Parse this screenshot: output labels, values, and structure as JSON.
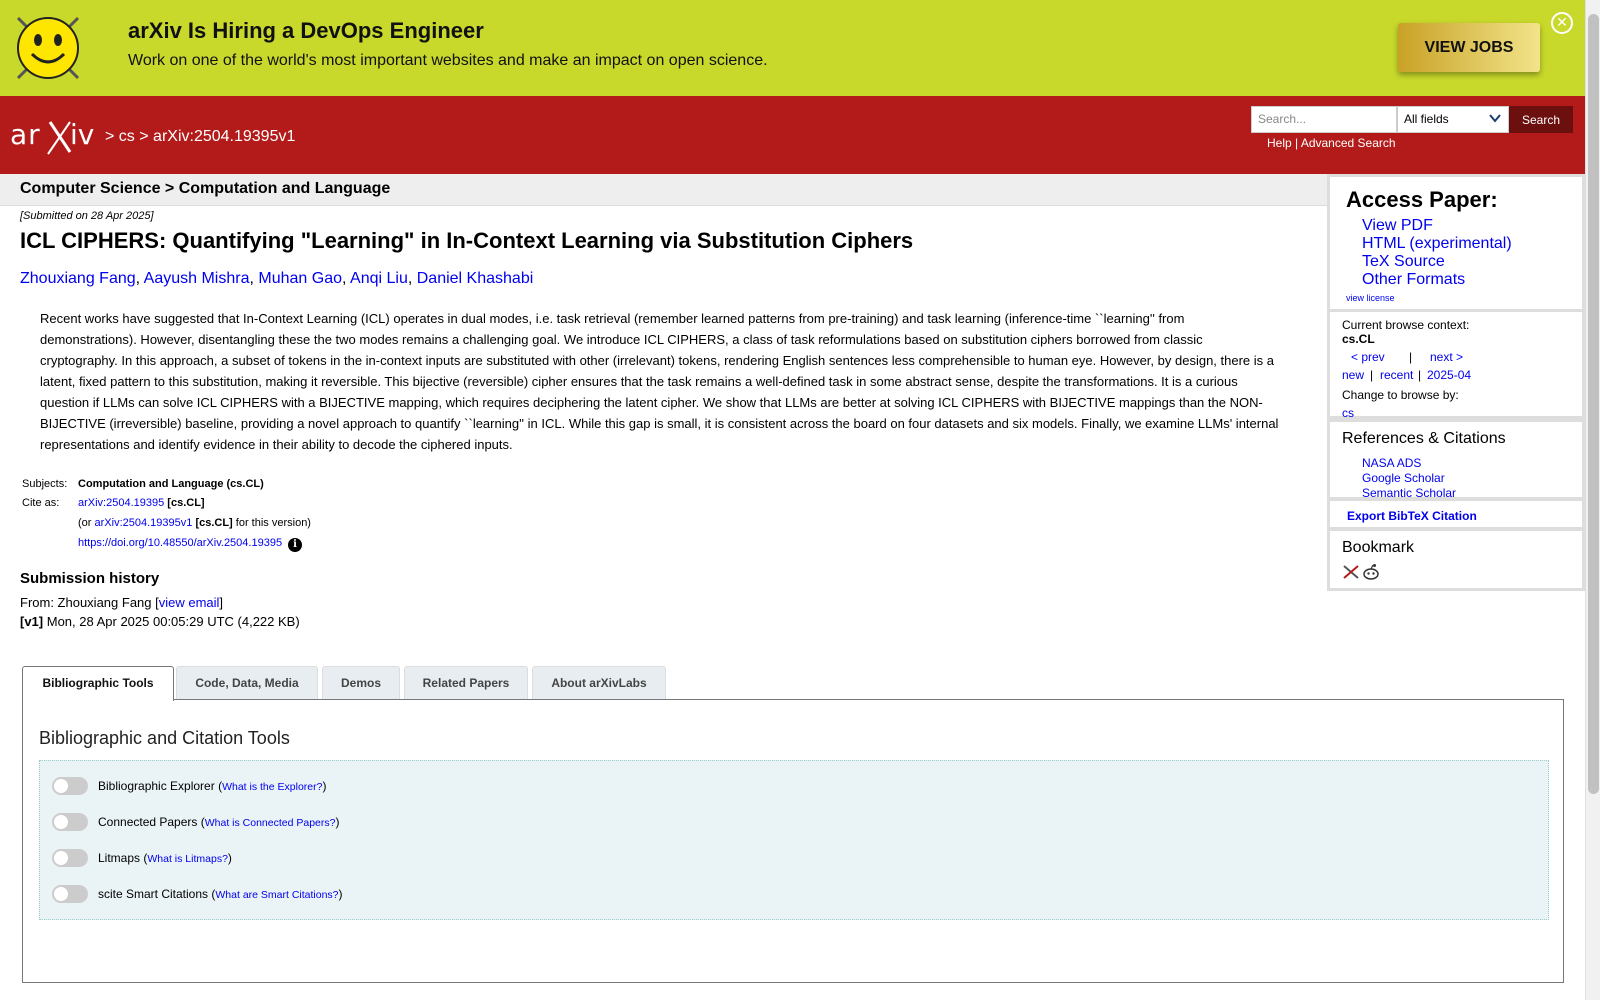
{
  "banner": {
    "title": "arXiv Is Hiring a DevOps Engineer",
    "subtitle": "Work on one of the world's most important websites and make an impact on open science.",
    "button": "VIEW JOBS",
    "close": "✕"
  },
  "header": {
    "breadcrumb_sep": ">",
    "breadcrumb_cs": "cs",
    "breadcrumb_id": "arXiv:2504.19395v1",
    "search_placeholder": "Search...",
    "search_field": "All fields",
    "search_button": "Search",
    "help": "Help",
    "links_sep": "|",
    "advanced": "Advanced Search"
  },
  "subheader": "Computer Science > Computation and Language",
  "paper": {
    "submitted": "[Submitted on 28 Apr 2025]",
    "title": "ICL CIPHERS: Quantifying \"Learning\" in In-Context Learning via Substitution Ciphers",
    "authors": [
      "Zhouxiang Fang",
      "Aayush Mishra",
      "Muhan Gao",
      "Anqi Liu",
      "Daniel Khashabi"
    ],
    "author_sep": ",",
    "abstract": "Recent works have suggested that In-Context Learning (ICL) operates in dual modes, i.e. task retrieval (remember learned patterns from pre-training) and task learning (inference-time ``learning'' from demonstrations). However, disentangling these the two modes remains a challenging goal. We introduce ICL CIPHERS, a class of task reformulations based on substitution ciphers borrowed from classic cryptography. In this approach, a subset of tokens in the in-context inputs are substituted with other (irrelevant) tokens, rendering English sentences less comprehensible to human eye. However, by design, there is a latent, fixed pattern to this substitution, making it reversible. This bijective (reversible) cipher ensures that the task remains a well-defined task in some abstract sense, despite the transformations. It is a curious question if LLMs can solve ICL CIPHERS with a BIJECTIVE mapping, which requires deciphering the latent cipher. We show that LLMs are better at solving ICL CIPHERS with BIJECTIVE mappings than the NON-BIJECTIVE (irreversible) baseline, providing a novel approach to quantify ``learning'' in ICL. While this gap is small, it is consistent across the board on four datasets and six models. Finally, we examine LLMs' internal representations and identify evidence in their ability to decode the ciphered inputs."
  },
  "meta": {
    "subjects_label": "Subjects:",
    "subjects_value": "Computation and Language (cs.CL)",
    "cite_label": "Cite as:",
    "cite_id": "arXiv:2504.19395",
    "cite_tag": "[cs.CL]",
    "or_open": "(or",
    "cite_version": "arXiv:2504.19395v1",
    "version_tag": "[cs.CL]",
    "for_version": "for this version)",
    "doi": "https://doi.org/10.48550/arXiv.2504.19395",
    "info_glyph": "i"
  },
  "history": {
    "title": "Submission history",
    "from_prefix": "From: Zhouxiang Fang [",
    "view_email": "view email",
    "from_suffix": "]",
    "v1_label": "[v1]",
    "v1_text": " Mon, 28 Apr 2025 00:05:29 UTC (4,222 KB)"
  },
  "tabs": [
    {
      "label": "Bibliographic Tools"
    },
    {
      "label": "Code, Data, Media"
    },
    {
      "label": "Demos"
    },
    {
      "label": "Related Papers"
    },
    {
      "label": "About arXivLabs"
    }
  ],
  "tools": {
    "title": "Bibliographic and Citation Tools",
    "items": [
      {
        "name": "Bibliographic Explorer",
        "link": "What is the Explorer?"
      },
      {
        "name": "Connected Papers",
        "link": "What is Connected Papers?"
      },
      {
        "name": "Litmaps",
        "link": "What is Litmaps?"
      },
      {
        "name": "scite Smart Citations",
        "link": "What are Smart Citations?"
      }
    ],
    "open_paren": " (",
    "close_paren": ")"
  },
  "sidebar": {
    "access_title": "Access Paper:",
    "access_links": [
      "View PDF",
      "HTML (experimental)",
      "TeX Source",
      "Other Formats"
    ],
    "view_license": "view license",
    "context_label": "Current browse context:",
    "context_value": "cs.CL",
    "prev": "< prev",
    "pipe": "|",
    "next": "next >",
    "new": "new",
    "recent": "recent",
    "month": "2025-04",
    "change_label": "Change to browse by:",
    "change_value": "cs",
    "refs_title": "References & Citations",
    "refs": [
      "NASA ADS",
      "Google Scholar",
      "Semantic Scholar"
    ],
    "bibtex": "Export BibTeX Citation",
    "bookmark": "Bookmark"
  },
  "colors": {
    "banner_bg": "#c8d92b",
    "header_red": "#b31b1b",
    "link_blue": "#0000ee"
  }
}
